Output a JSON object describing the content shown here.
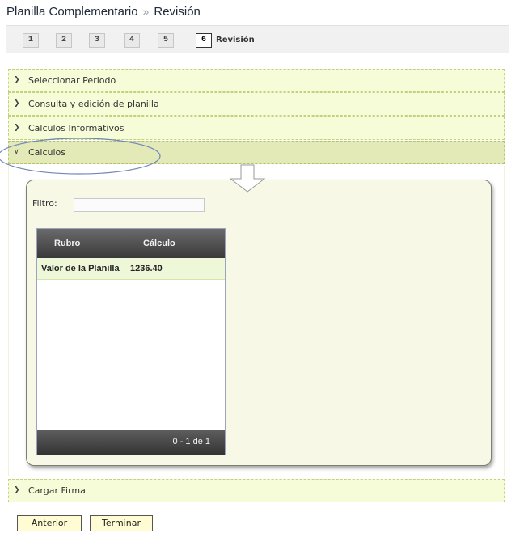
{
  "header": {
    "title": "Planilla Complementario",
    "separator": "»",
    "current": "Revisión"
  },
  "steps": [
    {
      "label": "1"
    },
    {
      "label": "2"
    },
    {
      "label": "3"
    },
    {
      "label": "4"
    },
    {
      "label": "5"
    },
    {
      "label": "6",
      "name": "Revisión",
      "active": true
    }
  ],
  "sections": [
    {
      "label": "Seleccionar Periodo",
      "expanded": false
    },
    {
      "label": "Consulta y edición de planilla",
      "expanded": false
    },
    {
      "label": "Calculos Informativos",
      "expanded": false
    },
    {
      "label": "Calculos",
      "expanded": true
    },
    {
      "label": "Cargar Firma",
      "expanded": false
    }
  ],
  "filter": {
    "label": "Filtro:",
    "value": "",
    "placeholder": ""
  },
  "grid": {
    "columns": [
      "Rubro",
      "Cálculo"
    ],
    "rows": [
      [
        "Valor de la Planilla",
        "1236.40"
      ]
    ],
    "pager": "0 - 1 de 1"
  },
  "buttons": {
    "prev": "Anterior",
    "finish": "Terminar"
  },
  "colors": {
    "accordion_bg": "#f6fbd8",
    "accordion_open_bg": "#e3eab8",
    "grid_header": "#4a4a4a",
    "row_highlight": "#eef8d8",
    "button_bg": "#fffbd2"
  }
}
